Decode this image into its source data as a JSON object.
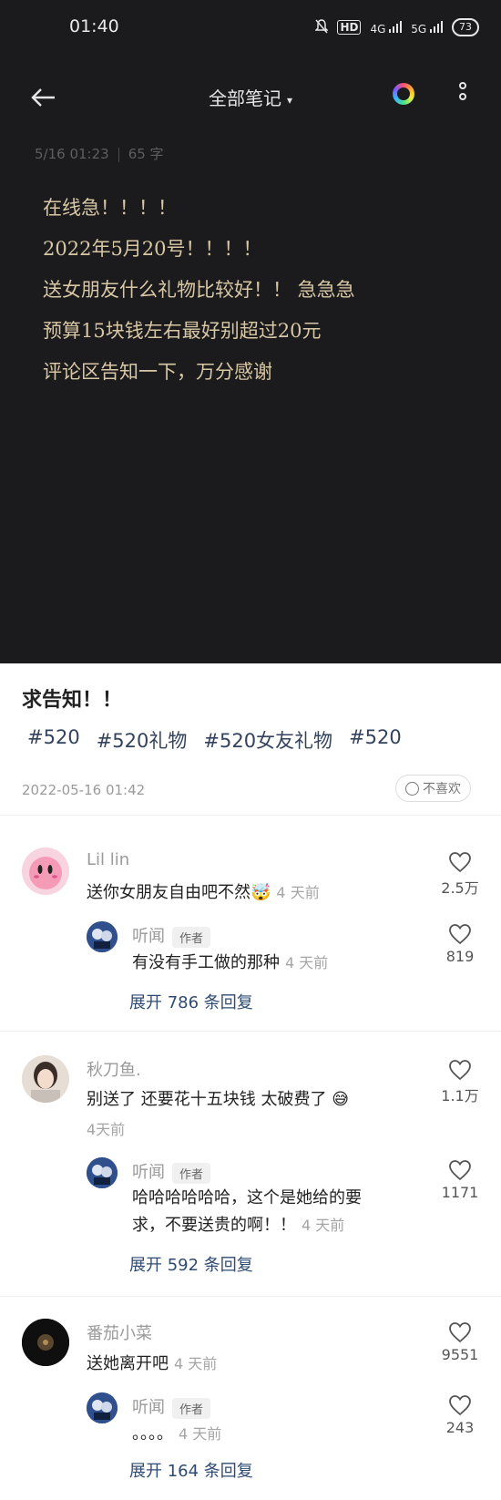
{
  "status_bar": {
    "time": "01:40",
    "network": "HD",
    "signal1": "4G",
    "signal2": "5G",
    "battery": "73"
  },
  "nav": {
    "title": "全部笔记",
    "caret": "▾",
    "back_icon": "arrow-left-icon",
    "ring_icon": "color-ring-icon",
    "more_icon": "more-vertical-icon"
  },
  "note": {
    "date": "5/16 01:23",
    "word_count": "65 字",
    "lines": [
      "在线急！！！！",
      "2022年5月20号！！！！",
      "送女朋友什么礼物比较好！！ 急急急",
      "预算15块钱左右最好别超过20元",
      "评论区告知一下，万分感谢"
    ]
  },
  "post": {
    "title": "求告知！！",
    "tags": [
      "#520",
      "#520礼物",
      "#520女友礼物",
      "#520"
    ],
    "date": "2022-05-16 01:42",
    "dislike_label": "不喜欢"
  },
  "comments": [
    {
      "name": "Lil lin",
      "text": "送你女朋友自由吧不然",
      "emoji": "🤯",
      "time": "4 天前",
      "likes": "2.5万",
      "reply": {
        "name": "听闻",
        "badge": "作者",
        "text": "有没有手工做的那种",
        "time": "4 天前",
        "likes": "819"
      },
      "expand": "展开 786 条回复"
    },
    {
      "name": "秋刀鱼.",
      "text": "别送了  还要花十五块钱 太破费了",
      "emoji": "😅",
      "time": "4天前",
      "likes": "1.1万",
      "reply": {
        "name": "听闻",
        "badge": "作者",
        "text_line1": "哈哈哈哈哈哈，这个是她给的要",
        "text_line2": "求，不要送贵的啊！！",
        "time": "4 天前",
        "likes": "1171"
      },
      "expand": "展开 592 条回复"
    },
    {
      "name": "番茄小菜",
      "text": "送她离开吧",
      "time": "4 天前",
      "likes": "9551",
      "reply": {
        "name": "听闻",
        "badge": "作者",
        "text": "。。。。",
        "time": "4 天前",
        "likes": "243"
      },
      "expand": "展开 164 条回复"
    }
  ],
  "colors": {
    "note_bg": "#1b1b1d",
    "note_text": "#d8c7a5",
    "tag_color": "#33435f",
    "expand_color": "#2e4b73"
  }
}
